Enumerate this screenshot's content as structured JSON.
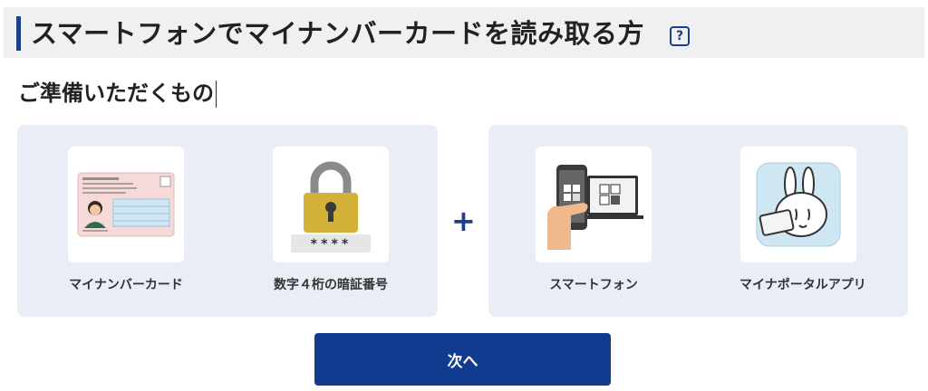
{
  "header": {
    "title": "スマートフォンでマイナンバーカードを読み取る方",
    "help_icon_glyph": "?"
  },
  "section": {
    "heading": "ご準備いただくもの"
  },
  "items": [
    {
      "label": "マイナンバーカード",
      "icon": "my-number-card-icon"
    },
    {
      "label": "数字４桁の暗証番号",
      "icon": "padlock-pin-icon",
      "pin_mask": "****"
    },
    {
      "label": "スマートフォン",
      "icon": "smartphone-qr-icon"
    },
    {
      "label": "マイナポータルアプリ",
      "icon": "mynaportal-app-icon"
    }
  ],
  "plus_sign": "+",
  "next_button": {
    "label": "次へ"
  },
  "colors": {
    "accent": "#103b8e",
    "panel": "#e9edf5",
    "header_bg": "#eef0f2"
  }
}
